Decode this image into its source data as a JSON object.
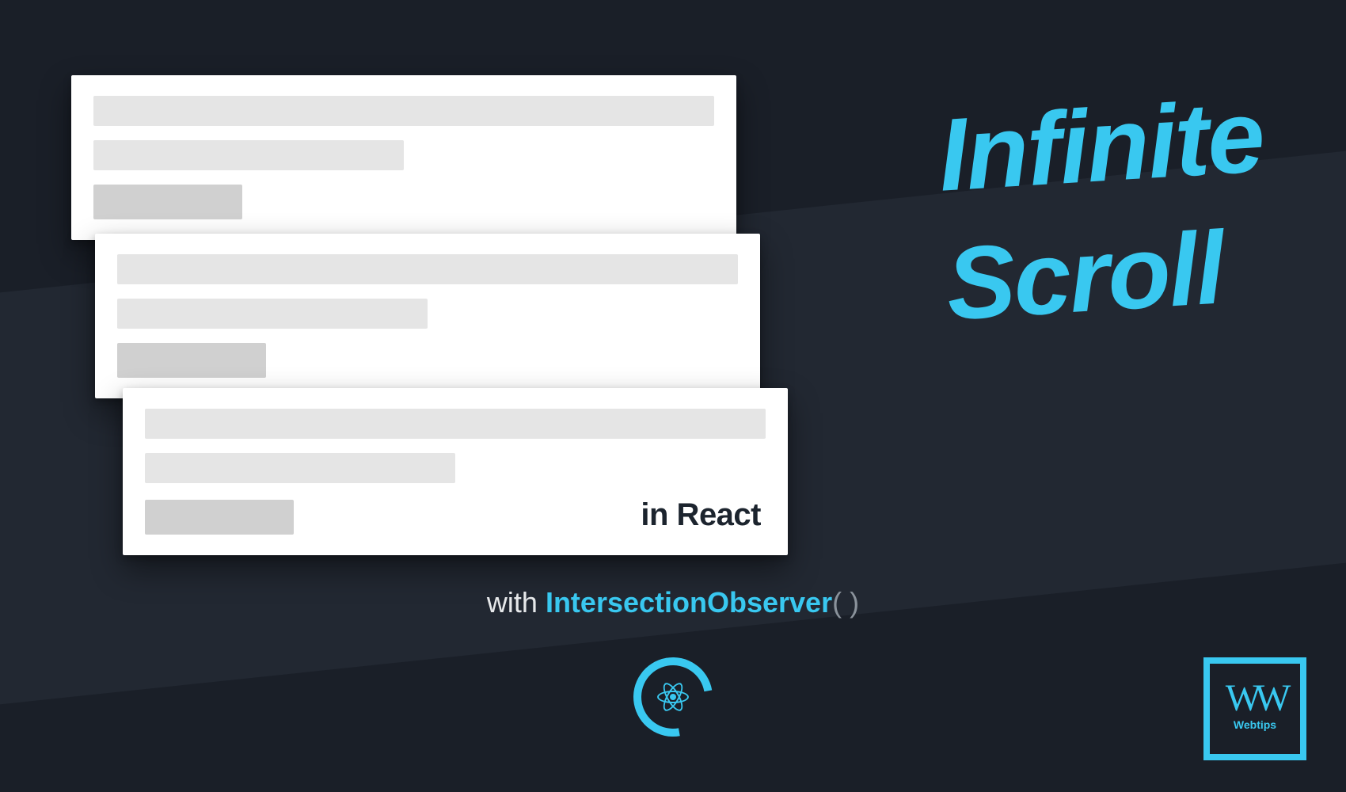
{
  "headline": {
    "line1": "Infinite",
    "line2": "Scroll"
  },
  "card_label": "in React",
  "subline": {
    "with": "with ",
    "api": "IntersectionObserver",
    "parens": "( )"
  },
  "logo": {
    "mark": "WW",
    "tag": "Webtips"
  },
  "colors": {
    "accent": "#39c8f0",
    "bg_dark": "#1a1f28",
    "bg_band": "#222832"
  }
}
